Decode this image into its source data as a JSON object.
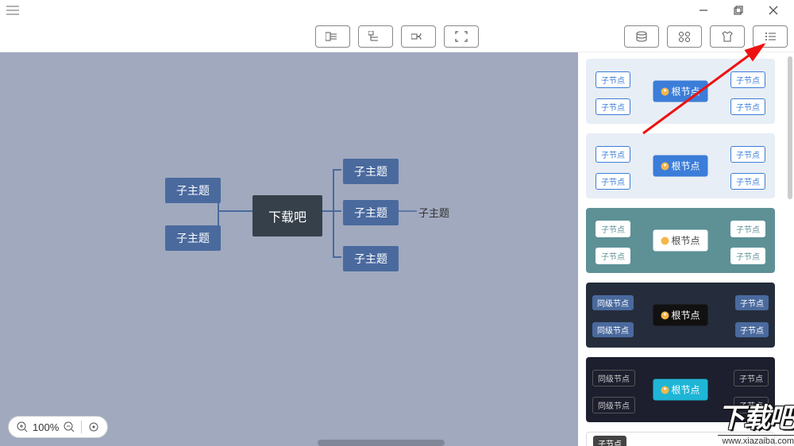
{
  "titlebar": {
    "minimize": "—",
    "maximize": "❐",
    "close": "✕"
  },
  "toolbar": {
    "center": [
      "layout-1",
      "layout-2",
      "layout-3",
      "focus"
    ],
    "right": [
      "grid",
      "apps",
      "shirt",
      "list"
    ]
  },
  "canvas": {
    "root": "下载吧",
    "left_children": [
      "子主题",
      "子主题"
    ],
    "right_children": [
      "子主题",
      "子主题",
      "子主题"
    ],
    "grand_child": "子主题"
  },
  "zoom": {
    "level": "100%"
  },
  "themes": [
    {
      "root": "根节点",
      "leaves": [
        "子节点",
        "子节点",
        "子节点",
        "子节点"
      ]
    },
    {
      "root": "根节点",
      "leaves": [
        "子节点",
        "子节点",
        "子节点",
        "子节点"
      ]
    },
    {
      "root": "根节点",
      "leaves": [
        "子节点",
        "子节点",
        "子节点",
        "子节点"
      ]
    },
    {
      "root": "根节点",
      "leaves": [
        "同级节点",
        "同级节点",
        "子节点",
        "子节点"
      ]
    },
    {
      "root": "根节点",
      "leaves": [
        "同级节点",
        "同级节点",
        "子节点",
        "子节点"
      ]
    },
    {
      "root": "",
      "leaves": [
        "子节点",
        "",
        "",
        ""
      ]
    }
  ],
  "watermark": {
    "text": "下载吧",
    "url": "www.xiazaiba.com"
  }
}
